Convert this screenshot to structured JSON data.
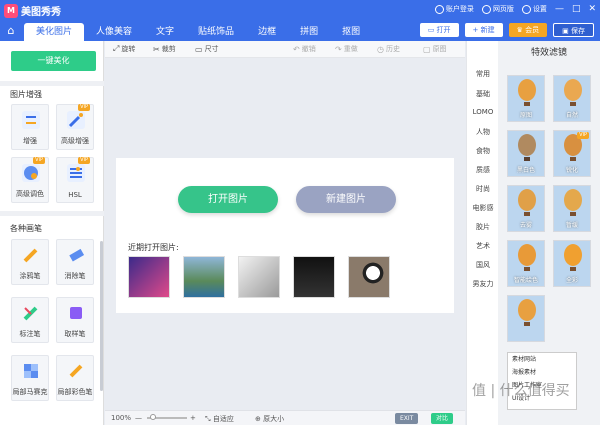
{
  "app": {
    "title": "美图秀秀",
    "account_label": "账户登录",
    "web_label": "网页版",
    "settings_label": "设置",
    "win_min": "—",
    "win_max": "□",
    "win_close": "✕"
  },
  "tabs": [
    {
      "label": "美化图片"
    },
    {
      "label": "人像美容"
    },
    {
      "label": "文字"
    },
    {
      "label": "贴纸饰品"
    },
    {
      "label": "边框"
    },
    {
      "label": "拼图"
    },
    {
      "label": "抠图"
    }
  ],
  "tab_buttons": {
    "open": "打开",
    "new": "新建",
    "vip": "会员",
    "save": "保存"
  },
  "left": {
    "onekey": "一键美化",
    "enhance_title": "图片增强",
    "enhance_tools": [
      {
        "label": "增强",
        "vip": false,
        "icon": "sliders-icon"
      },
      {
        "label": "高级增强",
        "vip": true,
        "icon": "magic-wand-icon"
      },
      {
        "label": "高级调色",
        "vip": true,
        "icon": "palette-icon"
      },
      {
        "label": "HSL",
        "vip": true,
        "icon": "hsl-icon"
      }
    ],
    "brush_title": "各种画笔",
    "brush_tools": [
      {
        "label": "涂鸦笔",
        "icon": "pencil-icon"
      },
      {
        "label": "消除笔",
        "icon": "eraser-icon"
      },
      {
        "label": "标注笔",
        "icon": "marker-icon"
      },
      {
        "label": "取样笔",
        "icon": "sampler-icon"
      },
      {
        "label": "局部马赛克",
        "icon": "mosaic-icon"
      },
      {
        "label": "局部彩色笔",
        "icon": "color-brush-icon"
      }
    ],
    "vip_tag": "VIP"
  },
  "toolbar": {
    "rotate": "旋转",
    "crop": "裁剪",
    "size": "尺寸",
    "undo": "撤销",
    "redo": "重做",
    "history": "历史",
    "original": "原图"
  },
  "canvas": {
    "open_button": "打开图片",
    "new_button": "新建图片",
    "recent_label": "近期打开图片:"
  },
  "statusbar": {
    "zoom": "100%",
    "zoom_minus": "—",
    "zoom_plus": "+",
    "fit": "自适应",
    "actual": "原大小",
    "exit": "EXIT",
    "compare": "对比"
  },
  "categories": [
    "常用",
    "基础",
    "LOMO",
    "人物",
    "食物",
    "质感",
    "时尚",
    "电影感",
    "胶片",
    "艺术",
    "国风",
    "男友力"
  ],
  "filters": {
    "title": "特效滤镜",
    "items": [
      {
        "label": "原图",
        "vip": false
      },
      {
        "label": "自然",
        "vip": false
      },
      {
        "label": "黑白色",
        "vip": false
      },
      {
        "label": "锐化",
        "vip": true
      },
      {
        "label": "去雾",
        "vip": false
      },
      {
        "label": "暂缓",
        "vip": false
      },
      {
        "label": "智能绘色",
        "vip": false
      },
      {
        "label": "全彩",
        "vip": false
      },
      {
        "label": "",
        "vip": false
      }
    ]
  },
  "popup": {
    "items": [
      "素材网站",
      "海报素材",
      "图片工作室",
      "UI设计"
    ]
  },
  "watermark": "值 | 什么值得买",
  "colors": {
    "brand_blue": "#3a6ee8",
    "green": "#2ecc89",
    "vip_orange": "#f5a623",
    "new_button": "#9aa3c2"
  }
}
